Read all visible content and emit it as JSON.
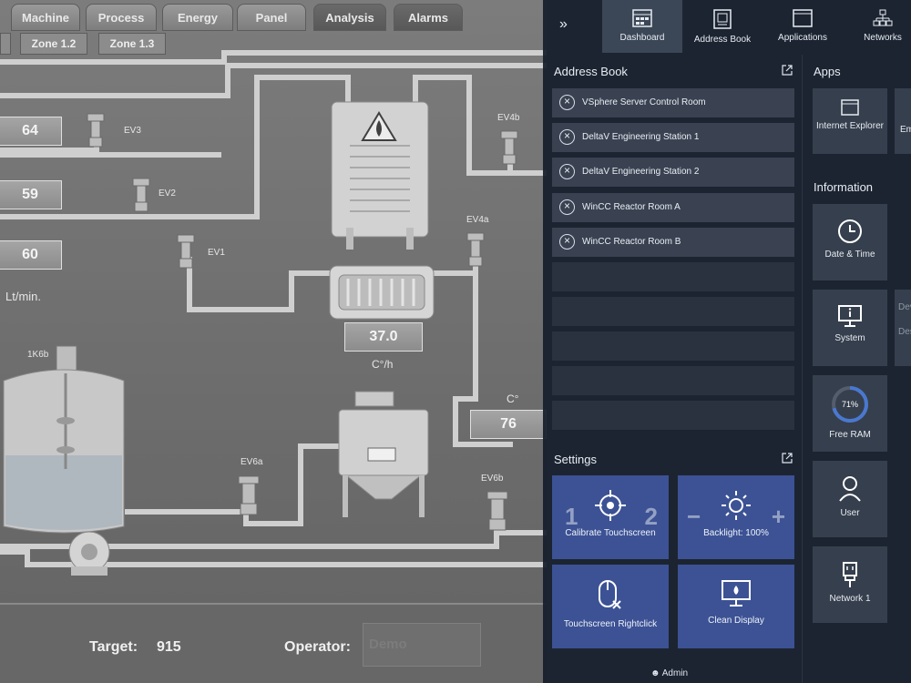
{
  "hmi": {
    "tabs": [
      "Machine",
      "Process",
      "Energy",
      "Panel",
      "Analysis",
      "Alarms"
    ],
    "zones": [
      "Zone 1.2",
      "Zone 1.3"
    ],
    "flow_values": [
      "64",
      "59",
      "60"
    ],
    "flow_unit": "Lt/min.",
    "valves": [
      "EV3",
      "EV2",
      "EV1",
      "EV4b",
      "EV4a",
      "EV6a",
      "EV6b"
    ],
    "tank_label": "1K6b",
    "heater_value": "37.0",
    "heater_unit": "C°/h",
    "temp_unit": "C°",
    "temp_value": "76",
    "target_label": "Target:",
    "target_value": "915",
    "operator_label": "Operator:",
    "operator_value": "Demo"
  },
  "panel": {
    "nav": [
      {
        "label": "Dashboard",
        "icon": "dashboard-icon",
        "active": true
      },
      {
        "label": "Address Book",
        "icon": "address-book-icon",
        "active": false
      },
      {
        "label": "Applications",
        "icon": "applications-icon",
        "active": false
      },
      {
        "label": "Networks",
        "icon": "networks-icon",
        "active": false
      }
    ],
    "expand_glyph": "»",
    "address_book": {
      "title": "Address Book",
      "entries": [
        "VSphere Server Control Room",
        "DeltaV Engineering Station 1",
        "DeltaV Engineering Station 2",
        "WinCC Reactor Room A",
        "WinCC Reactor Room B"
      ]
    },
    "settings": {
      "title": "Settings",
      "tiles": [
        "Calibrate Touchscreen",
        "Backlight: 100%",
        "Touchscreen Rightclick",
        "Clean Display"
      ],
      "calibrate_left": "1",
      "calibrate_right": "2",
      "backlight_minus": "−",
      "backlight_plus": "+"
    },
    "apps": {
      "title": "Apps",
      "items": [
        "Internet Explorer",
        "Em"
      ]
    },
    "information": {
      "title": "Information",
      "items": [
        "Date & Time",
        "System",
        "Free RAM",
        "User",
        "Network 1"
      ],
      "ram_percent": "71%",
      "ram_fraction": 0.71,
      "side_fragments": [
        "Devi",
        "Desc"
      ]
    },
    "footer_user": "Admin",
    "accent_color": "#3c5294"
  }
}
